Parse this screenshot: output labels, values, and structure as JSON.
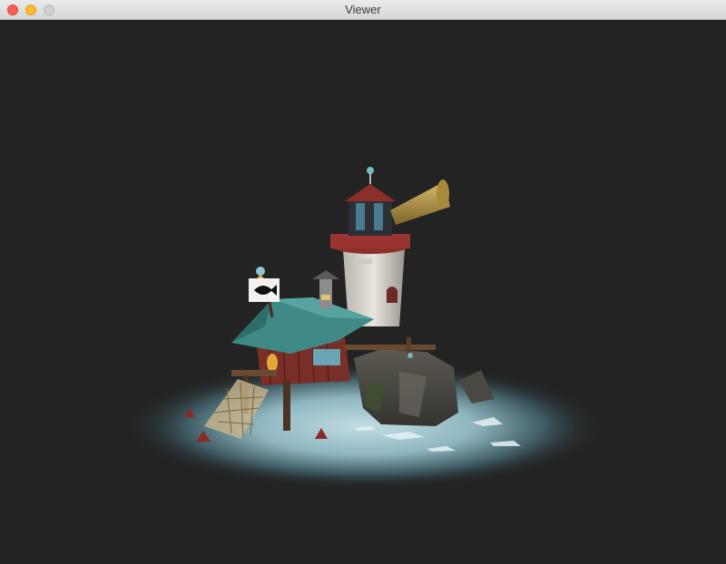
{
  "window": {
    "title": "Viewer",
    "controls": [
      "close",
      "minimize",
      "zoom"
    ]
  },
  "scene": {
    "description_icon": "lighthouse-island-3d-model",
    "background_color": "#232323",
    "water_color": "#b6d3da"
  }
}
